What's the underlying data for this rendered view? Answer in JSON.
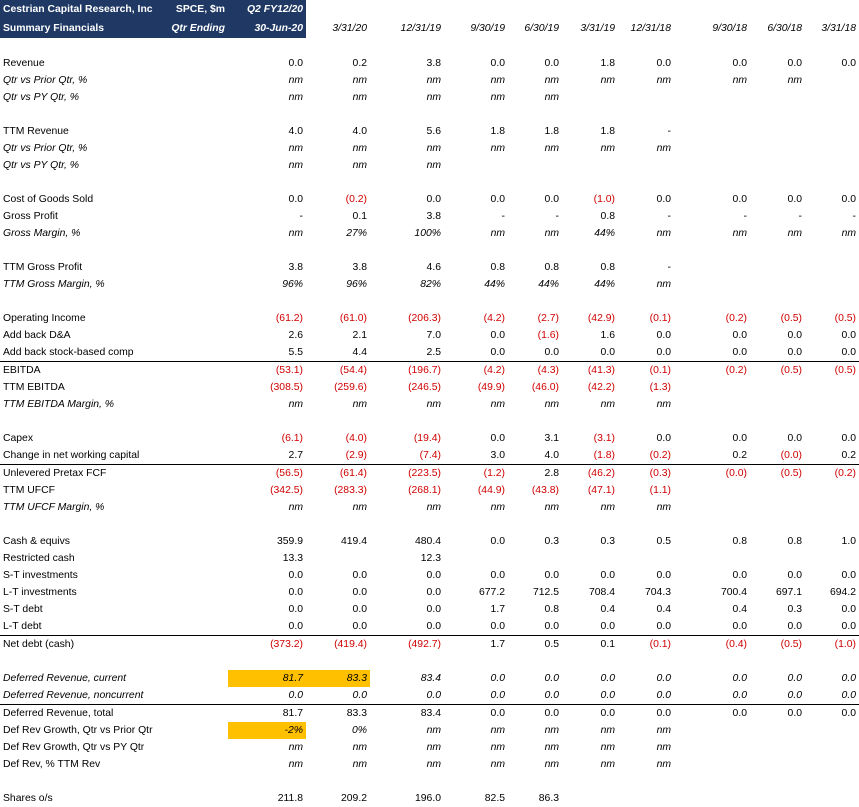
{
  "header": {
    "row1": [
      "Cestrian Capital Research, Inc",
      "SPCE, $m",
      "Q2 FY12/20",
      "",
      "",
      "",
      "",
      "",
      "",
      "",
      "",
      ""
    ],
    "row2": [
      "Summary Financials",
      "Qtr Ending",
      "30-Jun-20",
      "3/31/20",
      "12/31/19",
      "9/30/19",
      "6/30/19",
      "3/31/19",
      "12/31/18",
      "9/30/18",
      "6/30/18",
      "3/31/18"
    ]
  },
  "rows": [
    {
      "gap": true
    },
    {
      "label": "Revenue",
      "values": [
        "",
        "0.0",
        "0.2",
        "3.8",
        "0.0",
        "0.0",
        "1.8",
        "0.0",
        "0.0",
        "0.0",
        "0.0"
      ]
    },
    {
      "label": "Qtr vs Prior Qtr, %",
      "italic": true,
      "values": [
        "",
        "nm",
        "nm",
        "nm",
        "nm",
        "nm",
        "nm",
        "nm",
        "nm",
        "nm",
        ""
      ]
    },
    {
      "label": "Qtr vs PY Qtr, %",
      "italic": true,
      "values": [
        "",
        "nm",
        "nm",
        "nm",
        "nm",
        "nm",
        "",
        "",
        "",
        "",
        ""
      ]
    },
    {
      "gap": true
    },
    {
      "label": "TTM Revenue",
      "values": [
        "",
        "4.0",
        "4.0",
        "5.6",
        "1.8",
        "1.8",
        "1.8",
        "-",
        "",
        "",
        ""
      ]
    },
    {
      "label": "Qtr vs Prior Qtr, %",
      "italic": true,
      "values": [
        "",
        "nm",
        "nm",
        "nm",
        "nm",
        "nm",
        "nm",
        "nm",
        "",
        "",
        ""
      ]
    },
    {
      "label": "Qtr vs PY Qtr, %",
      "italic": true,
      "values": [
        "",
        "nm",
        "nm",
        "nm",
        "",
        "",
        "",
        "",
        "",
        "",
        ""
      ]
    },
    {
      "gap": true
    },
    {
      "label": "Cost of Goods Sold",
      "values": [
        "",
        "0.0",
        "(0.2)",
        "0.0",
        "0.0",
        "0.0",
        "(1.0)",
        "0.0",
        "0.0",
        "0.0",
        "0.0"
      ]
    },
    {
      "label": "Gross Profit",
      "values": [
        "",
        "-",
        "0.1",
        "3.8",
        "-",
        "-",
        "0.8",
        "-",
        "-",
        "-",
        "-"
      ]
    },
    {
      "label": "Gross Margin, %",
      "italic": true,
      "values": [
        "",
        "nm",
        "27%",
        "100%",
        "nm",
        "nm",
        "44%",
        "nm",
        "nm",
        "nm",
        "nm"
      ]
    },
    {
      "gap": true
    },
    {
      "label": "TTM Gross Profit",
      "values": [
        "",
        "3.8",
        "3.8",
        "4.6",
        "0.8",
        "0.8",
        "0.8",
        "-",
        "",
        "",
        ""
      ]
    },
    {
      "label": "TTM Gross Margin, %",
      "italic": true,
      "values": [
        "",
        "96%",
        "96%",
        "82%",
        "44%",
        "44%",
        "44%",
        "nm",
        "",
        "",
        ""
      ]
    },
    {
      "gap": true
    },
    {
      "label": "Operating Income",
      "values": [
        "",
        "(61.2)",
        "(61.0)",
        "(206.3)",
        "(4.2)",
        "(2.7)",
        "(42.9)",
        "(0.1)",
        "(0.2)",
        "(0.5)",
        "(0.5)"
      ]
    },
    {
      "label": "Add back D&A",
      "values": [
        "",
        "2.6",
        "2.1",
        "7.0",
        "0.0",
        "(1.6)",
        "1.6",
        "0.0",
        "0.0",
        "0.0",
        "0.0"
      ]
    },
    {
      "label": "Add back stock-based comp",
      "values": [
        "",
        "5.5",
        "4.4",
        "2.5",
        "0.0",
        "0.0",
        "0.0",
        "0.0",
        "0.0",
        "0.0",
        "0.0"
      ]
    },
    {
      "label": "EBITDA",
      "topBorder": true,
      "values": [
        "",
        "(53.1)",
        "(54.4)",
        "(196.7)",
        "(4.2)",
        "(4.3)",
        "(41.3)",
        "(0.1)",
        "(0.2)",
        "(0.5)",
        "(0.5)"
      ]
    },
    {
      "label": "TTM EBITDA",
      "values": [
        "",
        "(308.5)",
        "(259.6)",
        "(246.5)",
        "(49.9)",
        "(46.0)",
        "(42.2)",
        "(1.3)",
        "",
        "",
        ""
      ]
    },
    {
      "label": "TTM EBITDA Margin, %",
      "italic": true,
      "values": [
        "",
        "nm",
        "nm",
        "nm",
        "nm",
        "nm",
        "nm",
        "nm",
        "",
        "",
        ""
      ]
    },
    {
      "gap": true
    },
    {
      "label": "Capex",
      "values": [
        "",
        "(6.1)",
        "(4.0)",
        "(19.4)",
        "0.0",
        "3.1",
        "(3.1)",
        "0.0",
        "0.0",
        "0.0",
        "0.0"
      ]
    },
    {
      "label": "Change in net working capital",
      "values": [
        "",
        "2.7",
        "(2.9)",
        "(7.4)",
        "3.0",
        "4.0",
        "(1.8)",
        "(0.2)",
        "0.2",
        "(0.0)",
        "0.2"
      ]
    },
    {
      "label": "Unlevered Pretax FCF",
      "topBorder": true,
      "values": [
        "",
        "(56.5)",
        "(61.4)",
        "(223.5)",
        "(1.2)",
        "2.8",
        "(46.2)",
        "(0.3)",
        "(0.0)",
        "(0.5)",
        "(0.2)"
      ]
    },
    {
      "label": "TTM UFCF",
      "values": [
        "",
        "(342.5)",
        "(283.3)",
        "(268.1)",
        "(44.9)",
        "(43.8)",
        "(47.1)",
        "(1.1)",
        "",
        "",
        ""
      ]
    },
    {
      "label": "TTM UFCF Margin, %",
      "italic": true,
      "values": [
        "",
        "nm",
        "nm",
        "nm",
        "nm",
        "nm",
        "nm",
        "nm",
        "",
        "",
        ""
      ]
    },
    {
      "gap": true
    },
    {
      "label": "Cash & equivs",
      "values": [
        "",
        "359.9",
        "419.4",
        "480.4",
        "0.0",
        "0.3",
        "0.3",
        "0.5",
        "0.8",
        "0.8",
        "1.0"
      ]
    },
    {
      "label": "Restricted cash",
      "values": [
        "",
        "13.3",
        "",
        "12.3",
        "",
        "",
        "",
        "",
        "",
        "",
        ""
      ]
    },
    {
      "label": "S-T investments",
      "values": [
        "",
        "0.0",
        "0.0",
        "0.0",
        "0.0",
        "0.0",
        "0.0",
        "0.0",
        "0.0",
        "0.0",
        "0.0"
      ]
    },
    {
      "label": "L-T investments",
      "values": [
        "",
        "0.0",
        "0.0",
        "0.0",
        "677.2",
        "712.5",
        "708.4",
        "704.3",
        "700.4",
        "697.1",
        "694.2"
      ]
    },
    {
      "label": "S-T debt",
      "values": [
        "",
        "0.0",
        "0.0",
        "0.0",
        "1.7",
        "0.8",
        "0.4",
        "0.4",
        "0.4",
        "0.3",
        "0.0"
      ]
    },
    {
      "label": "L-T debt",
      "values": [
        "",
        "0.0",
        "0.0",
        "0.0",
        "0.0",
        "0.0",
        "0.0",
        "0.0",
        "0.0",
        "0.0",
        "0.0"
      ]
    },
    {
      "label": "Net debt (cash)",
      "topBorder": true,
      "values": [
        "",
        "(373.2)",
        "(419.4)",
        "(492.7)",
        "1.7",
        "0.5",
        "0.1",
        "(0.1)",
        "(0.4)",
        "(0.5)",
        "(1.0)"
      ]
    },
    {
      "gap": true
    },
    {
      "label": "Deferred Revenue, current",
      "italic": true,
      "highlight": [
        1,
        2
      ],
      "values": [
        "",
        "81.7",
        "83.3",
        "83.4",
        "0.0",
        "0.0",
        "0.0",
        "0.0",
        "0.0",
        "0.0",
        "0.0"
      ]
    },
    {
      "label": "Deferred Revenue, noncurrent",
      "italic": true,
      "values": [
        "",
        "0.0",
        "0.0",
        "0.0",
        "0.0",
        "0.0",
        "0.0",
        "0.0",
        "0.0",
        "0.0",
        "0.0"
      ]
    },
    {
      "label": "Deferred Revenue, total",
      "topBorder": true,
      "values": [
        "",
        "81.7",
        "83.3",
        "83.4",
        "0.0",
        "0.0",
        "0.0",
        "0.0",
        "0.0",
        "0.0",
        "0.0"
      ]
    },
    {
      "label": "Def Rev Growth, Qtr vs Prior Qtr",
      "highlight": [
        1
      ],
      "italicValues": true,
      "values": [
        "",
        "-2%",
        "0%",
        "nm",
        "nm",
        "nm",
        "nm",
        "nm",
        "",
        "",
        ""
      ]
    },
    {
      "label": "Def Rev Growth, Qtr vs PY Qtr",
      "italicValues": true,
      "values": [
        "",
        "nm",
        "nm",
        "nm",
        "nm",
        "nm",
        "nm",
        "nm",
        "",
        "",
        ""
      ]
    },
    {
      "label": "Def Rev, % TTM Rev",
      "italicValues": true,
      "values": [
        "",
        "nm",
        "nm",
        "nm",
        "nm",
        "nm",
        "nm",
        "nm",
        "",
        "",
        ""
      ]
    },
    {
      "gap": true
    },
    {
      "label": "Shares o/s",
      "values": [
        "",
        "211.8",
        "209.2",
        "196.0",
        "82.5",
        "86.3",
        "",
        "",
        "",
        "",
        ""
      ]
    }
  ],
  "colors": {
    "header_bg": "#1f3864",
    "negative": "#d00000",
    "highlight": "#ffc000"
  }
}
